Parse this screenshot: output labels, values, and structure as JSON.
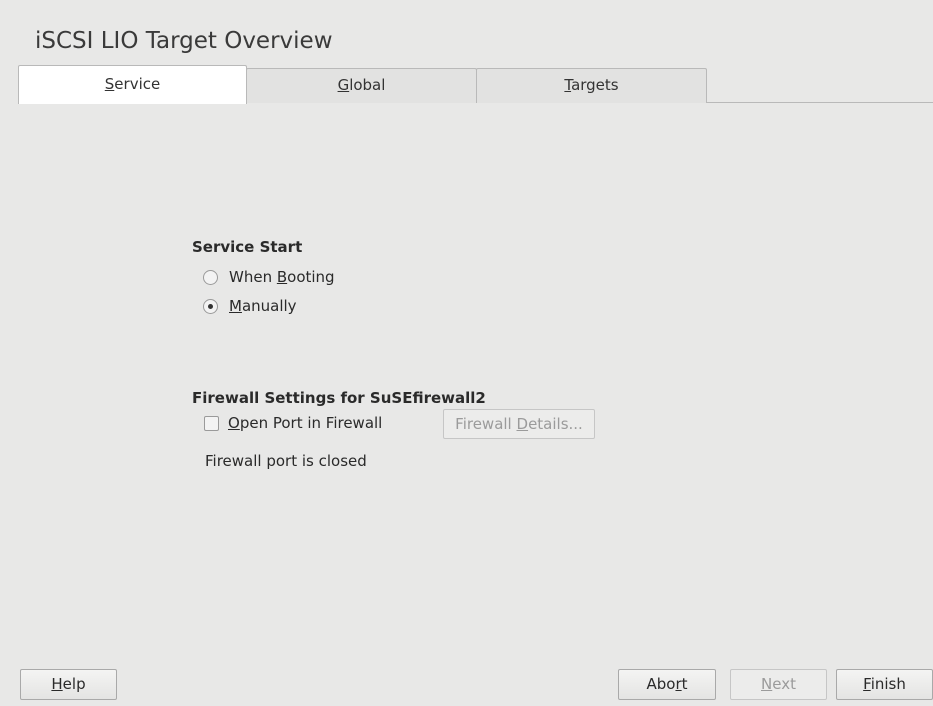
{
  "window": {
    "title": "iSCSI LIO Target Overview"
  },
  "tabs": [
    {
      "pre": "",
      "key": "S",
      "post": "ervice",
      "active": true
    },
    {
      "pre": "",
      "key": "G",
      "post": "lobal",
      "active": false
    },
    {
      "pre": "",
      "key": "T",
      "post": "argets",
      "active": false
    }
  ],
  "service_start": {
    "title": "Service Start",
    "options": [
      {
        "pre": "When ",
        "key": "B",
        "post": "ooting",
        "selected": false
      },
      {
        "pre": "",
        "key": "M",
        "post": "anually",
        "selected": true
      }
    ]
  },
  "firewall": {
    "title": "Firewall Settings for SuSEfirewall2",
    "open_port": {
      "pre": "",
      "key": "O",
      "post": "pen Port in Firewall",
      "checked": false
    },
    "details_button": {
      "pre": "Firewall ",
      "key": "D",
      "post": "etails...",
      "enabled": false
    },
    "status": "Firewall port is closed"
  },
  "footer": {
    "help": {
      "pre": "",
      "key": "H",
      "post": "elp"
    },
    "abort": {
      "pre": "Abo",
      "key": "r",
      "post": "t"
    },
    "next": {
      "pre": "",
      "key": "N",
      "post": "ext",
      "enabled": false
    },
    "finish": {
      "pre": "",
      "key": "F",
      "post": "inish"
    }
  }
}
